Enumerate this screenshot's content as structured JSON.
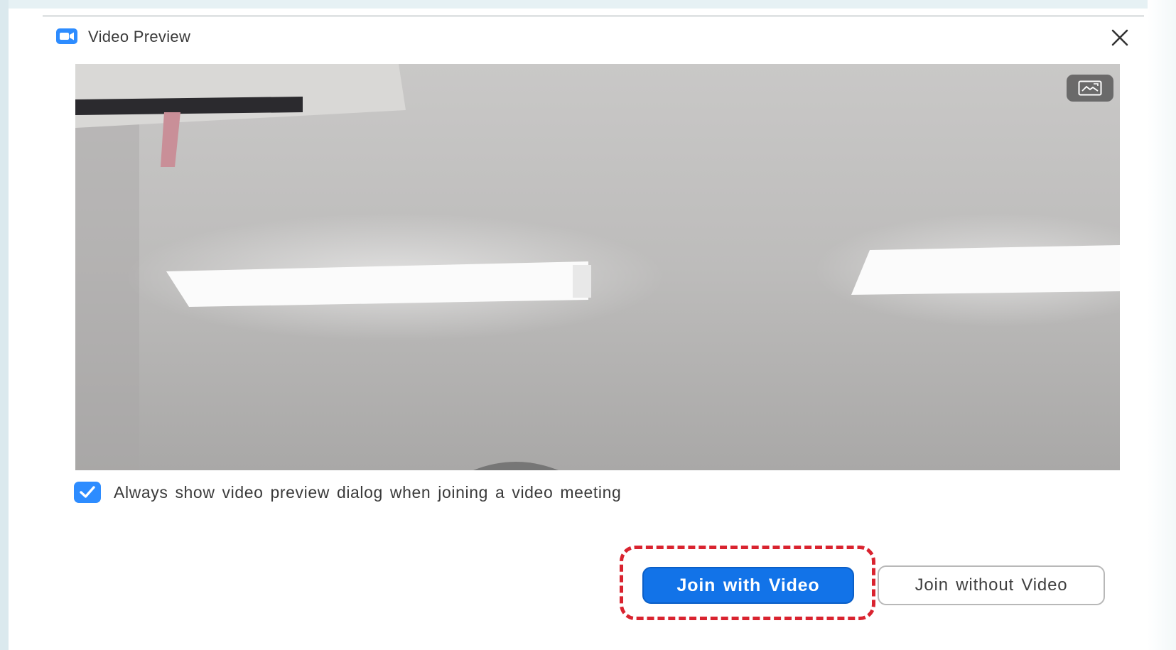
{
  "window": {
    "title": "Video Preview",
    "app_icon": "zoom-camera-icon",
    "close_icon": "close-icon"
  },
  "preview": {
    "toggle_icon": "aspect-ratio-icon"
  },
  "options": {
    "always_show_checked": true,
    "always_show_label": "Always show video preview dialog when joining a video meeting"
  },
  "actions": {
    "join_with_video_label": "Join with Video",
    "join_without_video_label": "Join without Video"
  },
  "colors": {
    "accent": "#2d8cff",
    "primary_button": "#1273e8",
    "highlight": "#d9232f"
  }
}
